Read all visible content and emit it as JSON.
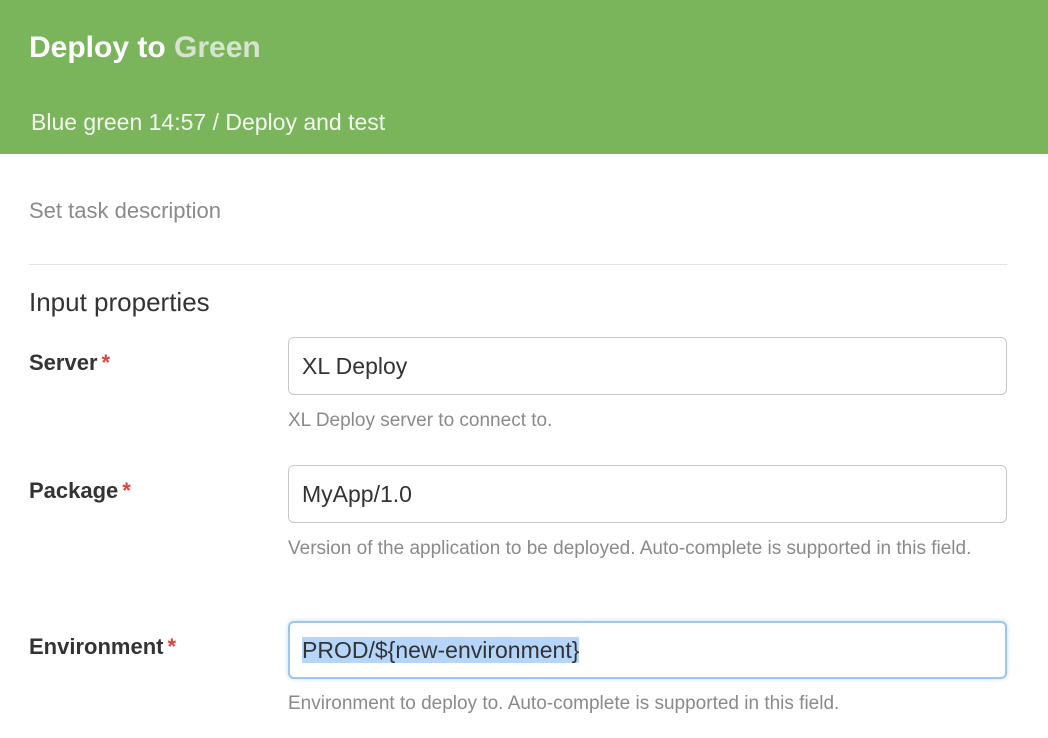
{
  "header": {
    "title_prefix": "Deploy to",
    "title_env": "Green",
    "breadcrumb": "Blue green 14:57 / Deploy and test",
    "background_color": "#7ab55c"
  },
  "task": {
    "description_placeholder": "Set task description"
  },
  "input_properties": {
    "section_title": "Input properties",
    "required_marker": "*",
    "fields": [
      {
        "label": "Server",
        "value": "XL Deploy",
        "help": "XL Deploy server to connect to."
      },
      {
        "label": "Package",
        "value": "MyApp/1.0",
        "help": "Version of the application to be deployed. Auto-complete is supported in this field."
      },
      {
        "label": "Environment",
        "value": "PROD/${new-environment}",
        "help": "Environment to deploy to. Auto-complete is supported in this field.",
        "focused": true,
        "text_selected": true
      }
    ]
  },
  "colors": {
    "required": "#e0413d",
    "focus_border": "#9ec5ea",
    "selection": "#b5d5fb"
  }
}
